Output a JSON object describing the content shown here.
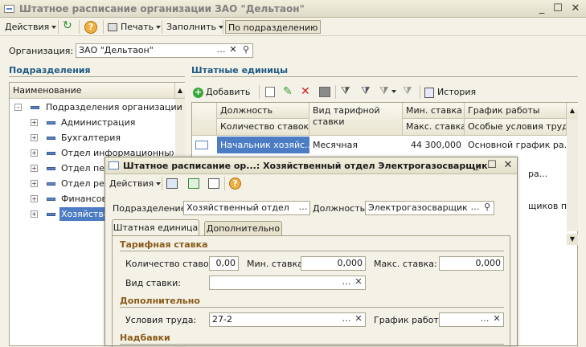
{
  "window": {
    "title": "Штатное расписание организации ЗАО \"Дельтаон\""
  },
  "toolbar": {
    "actions": "Действия",
    "print": "Печать",
    "fill": "Заполнить",
    "by_division": "По подразделению"
  },
  "org": {
    "label": "Организация:",
    "value": "ЗАО \"Дельтаон\""
  },
  "left": {
    "section": "Подразделения",
    "column": "Наименование",
    "root": "Подразделения организации",
    "items": [
      "Администрация",
      "Бухгалтерия",
      "Отдел информационных те",
      "Отдел пер",
      "Отдел рек",
      "Финансов",
      "Хозяйстве"
    ]
  },
  "right": {
    "section": "Штатные единицы",
    "add": "Добавить",
    "history": "История",
    "headers": {
      "position": "Должность",
      "count": "Количество ставок",
      "tariff": "Вид тарифной ставки",
      "min": "Мин. ставка",
      "max": "Макс. ставка",
      "schedule": "График работы",
      "conditions": "Особые условия труда"
    },
    "row1": {
      "position": "Начальник хозяйс...",
      "tariff": "Месячная",
      "min": "44 300,000",
      "schedule": "Основной график ра..."
    },
    "fragments": {
      "r2": "ра...",
      "r3": "ра...",
      "r4": "щиков п..."
    }
  },
  "dialog": {
    "title": "Штатное расписание ор...: Хозяйственный отдел Электрогазосварщик",
    "actions": "Действия",
    "division_label": "Подразделение:",
    "division_value": "Хозяйственный отдел",
    "position_label": "Должность:",
    "position_value": "Электрогазосварщик",
    "tabs": [
      "Штатная единица",
      "Дополнительно"
    ],
    "tariff_section": "Тарифная ставка",
    "count_label": "Количество ставок:",
    "count_value": "0,00",
    "min_label": "Мин. ставка:",
    "min_value": "0,000",
    "max_label": "Макс. ставка:",
    "max_value": "0,000",
    "rate_kind_label": "Вид ставки:",
    "rate_kind_value": "",
    "extra_section": "Дополнительно",
    "conditions_label": "Условия труда:",
    "conditions_value": "27-2",
    "schedule_label": "График работы:",
    "schedule_value": "",
    "bonus_section": "Надбавки"
  }
}
